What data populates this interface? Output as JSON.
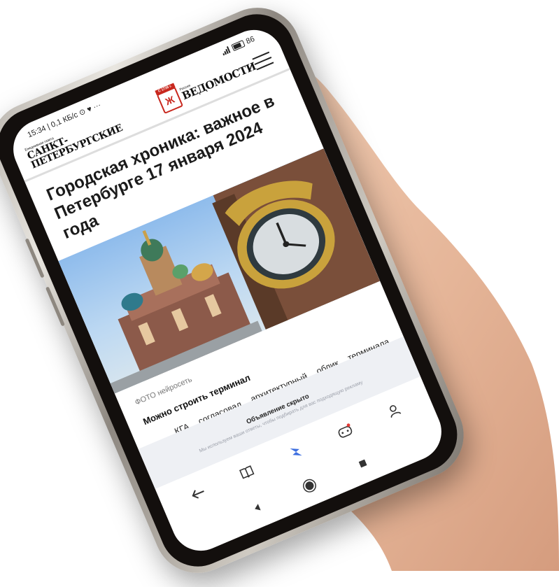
{
  "status_bar": {
    "left": "15:34 | 0,1 КБ/с ⊙ ♥ ···",
    "battery": "86"
  },
  "header": {
    "logo_left_small": "Ежедневная газета",
    "logo_left": "САНКТ-ПЕТЕРБУРГСКИЕ",
    "logo_emblem": "Ж",
    "logo_ribbon": "С 1728 г.",
    "logo_right_small": "Россия",
    "logo_right": "ВЕДОМОСТИ"
  },
  "article": {
    "headline": "Городская хроника: важное в Петербурге 17 января 2024 года",
    "photo_caption": "ФОТО нейросеть",
    "subhead": "Можно строить терминал",
    "body": "КГА согласовал архитектурный облик терминала высокоскоростной железнодорожной магистрали Петербург – Москва (ВСЖМ),"
  },
  "ad": {
    "title": "Объявление скрыто",
    "subtitle": "Мы используем ваши ответы, чтобы подбирать для вас подходящую рекламу"
  },
  "colors": {
    "brand_red": "#c8281e",
    "ad_bg": "#eef0f4"
  }
}
